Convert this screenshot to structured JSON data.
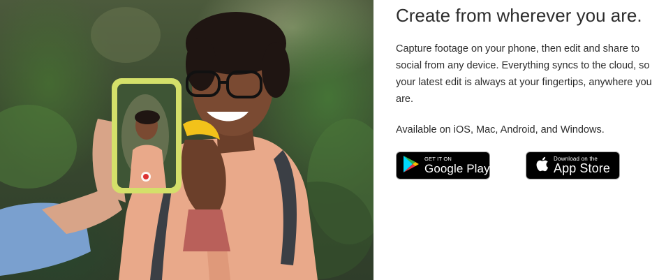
{
  "headline": "Create from wherever you are.",
  "description": "Capture footage on your phone, then edit and share to social from any device. Everything syncs to the cloud, so your latest edit is always at your fingertips, anywhere you are.",
  "availability": "Available on iOS, Mac, Android, and Windows.",
  "badges": {
    "google_play": {
      "small": "GET IT ON",
      "big": "Google Play",
      "icon": "google-play-icon"
    },
    "app_store": {
      "small": "Download on the",
      "big": "App Store",
      "icon": "apple-icon"
    }
  },
  "colors": {
    "text": "#2c2c2c",
    "badge_bg": "#000000",
    "badge_border": "#a6a6a6",
    "phone_case": "#d4e06a",
    "jacket": "#e9a98a"
  }
}
